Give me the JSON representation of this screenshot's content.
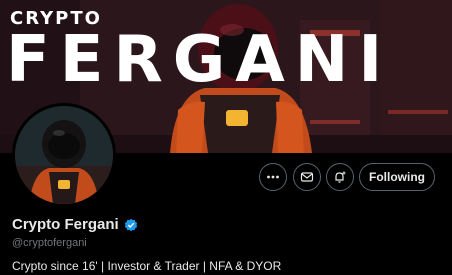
{
  "banner": {
    "brand_small": "CRYPTO",
    "brand_big": "FERGANI"
  },
  "actions": {
    "more_icon": "more-icon",
    "message_icon": "envelope-icon",
    "notify_icon": "bell-plus-icon",
    "follow_label": "Following"
  },
  "profile": {
    "display_name": "Crypto Fergani",
    "handle": "@cryptofergani",
    "bio": "Crypto since 16' | Investor & Trader | NFA & DYOR",
    "verified_color": "#1d9bf0"
  },
  "colors": {
    "background": "#000000",
    "suit_orange": "#d4561e",
    "visor_glow": "#f2b431"
  }
}
